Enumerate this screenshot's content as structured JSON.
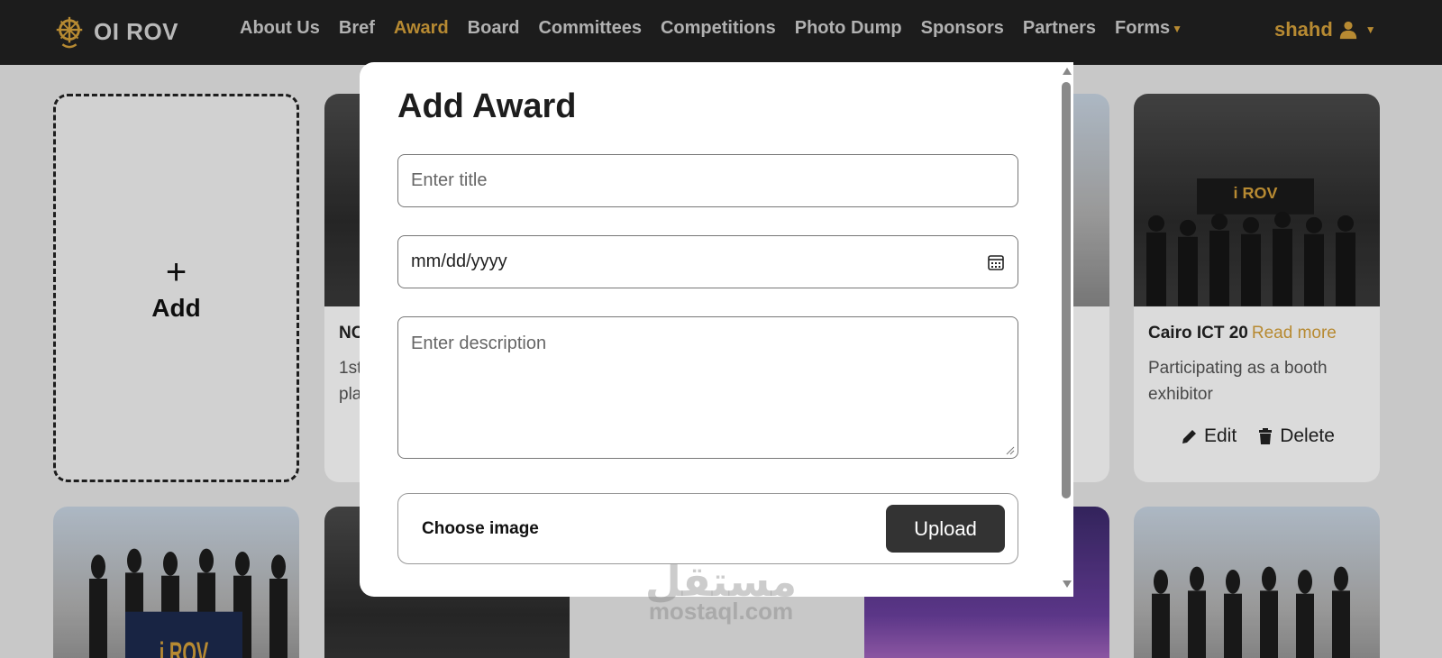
{
  "navbar": {
    "brand": "OI ROV",
    "links": [
      "About Us",
      "Bref",
      "Award",
      "Board",
      "Committees",
      "Competitions",
      "Photo Dump",
      "Sponsors",
      "Partners",
      "Forms"
    ],
    "active_link": "Award",
    "user": "shahd",
    "accent_color": "#d6a13b",
    "icons": {
      "user": "user-icon",
      "caret": "caret-down-icon"
    }
  },
  "grid": {
    "add_card": {
      "plus": "+",
      "label": "Add"
    },
    "cards": [
      {
        "title": "NC",
        "description": "1st\npla",
        "partial": true
      },
      {
        "title": "Cairo ICT 20",
        "read_more": "Read more",
        "description": "Participating as a booth exhibitor",
        "edit": "Edit",
        "delete": "Delete"
      }
    ]
  },
  "modal": {
    "title": "Add Award",
    "title_placeholder": "Enter title",
    "date_placeholder": "mm/dd/yyyy",
    "description_placeholder": "Enter description",
    "choose_image": "Choose image",
    "upload": "Upload",
    "icons": {
      "calendar": "calendar-icon"
    }
  },
  "watermark": {
    "arabic": "مستقل",
    "latin": "mostaql.com"
  }
}
